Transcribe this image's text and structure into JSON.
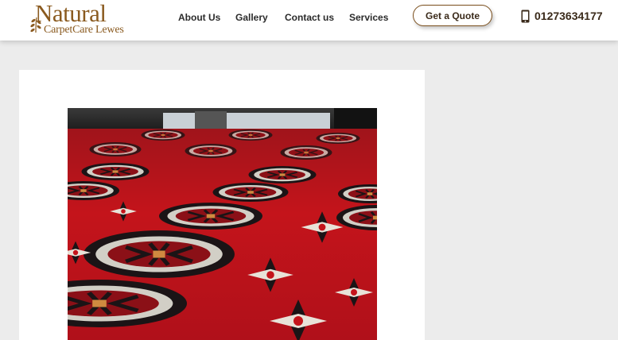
{
  "header": {
    "logo": {
      "line1": "Natural",
      "line2": "CarpetCare Lewes"
    },
    "nav": [
      {
        "label": "About Us"
      },
      {
        "label": "Gallery"
      },
      {
        "label": "Contact us"
      },
      {
        "label": "Services"
      }
    ],
    "quote_button": "Get a Quote",
    "phone": "01273634177",
    "phone_icon": "mobile-phone-icon"
  },
  "colors": {
    "brand_brown": "#8a5a1f",
    "button_border": "#7a4e1c",
    "page_background": "#ececec",
    "rug_red": "#c4141b"
  },
  "main": {
    "image": "red-patterned-carpet-photo"
  }
}
